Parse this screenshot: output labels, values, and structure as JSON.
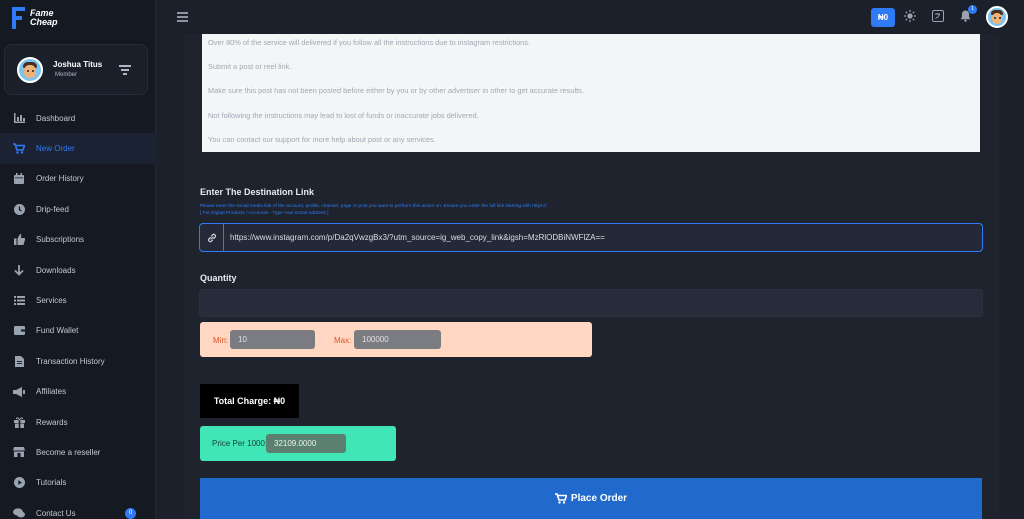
{
  "brand": {
    "line1": "Fame",
    "line2": "Cheap"
  },
  "profile": {
    "name": "Joshua Titus",
    "role": "Member"
  },
  "nav": [
    {
      "label": "Dashboard",
      "icon": "chart-icon"
    },
    {
      "label": "New Order",
      "icon": "cart-icon",
      "active": true
    },
    {
      "label": "Order History",
      "icon": "calendar-icon"
    },
    {
      "label": "Drip-feed",
      "icon": "clock-icon"
    },
    {
      "label": "Subscriptions",
      "icon": "thumbs-up-icon"
    },
    {
      "label": "Downloads",
      "icon": "arrow-down-icon"
    },
    {
      "label": "Services",
      "icon": "list-icon"
    },
    {
      "label": "Fund Wallet",
      "icon": "wallet-icon"
    },
    {
      "label": "Transaction History",
      "icon": "file-icon"
    },
    {
      "label": "Affiliates",
      "icon": "megaphone-icon"
    },
    {
      "label": "Rewards",
      "icon": "gift-icon"
    },
    {
      "label": "Become a reseller",
      "icon": "store-icon"
    },
    {
      "label": "Tutorials",
      "icon": "play-icon"
    },
    {
      "label": "Contact Us",
      "icon": "chat-icon",
      "badge": "0"
    }
  ],
  "header": {
    "balance": "₦0",
    "notification_count": "1"
  },
  "notes": [
    "Over 80% of the service will delivered if you follow all the instructions due to instagram restrictions.",
    "Submit a post or reel link.",
    "Make sure this post has not been posted before either by you or by other advertiser in other to get accurate results.",
    "Not following the instructions may lead to lost of funds or inaccurate jobs delivered.",
    "You can contact our support for more help about post or any services."
  ],
  "form": {
    "link_label": "Enter The Destination Link",
    "link_help_1": "Please enter the social media link of the account, profile, channel, page or post you want to perform this action on. Ensure you enter the full link starting with https://",
    "link_help_2": "[ For Digital Products / Accounts - Type Your Email Address ]",
    "link_value": "https://www.instagram.com/p/Da2qVwzgBx3/?utm_source=ig_web_copy_link&igsh=MzRlODBiNWFlZA==",
    "quantity_label": "Quantity",
    "quantity_value": "",
    "min_label": "Min:",
    "min_value": "10",
    "max_label": "Max:",
    "max_value": "100000",
    "total_charge": "Total Charge: ₦0",
    "price_label": "Price Per 1000:",
    "price_value": "32109.0000",
    "place_order": "Place Order"
  },
  "colors": {
    "accent": "#2f7bf6",
    "minmax_bg": "#ffd7c2",
    "price_bg": "#41e6b6",
    "button": "#2169cc"
  }
}
